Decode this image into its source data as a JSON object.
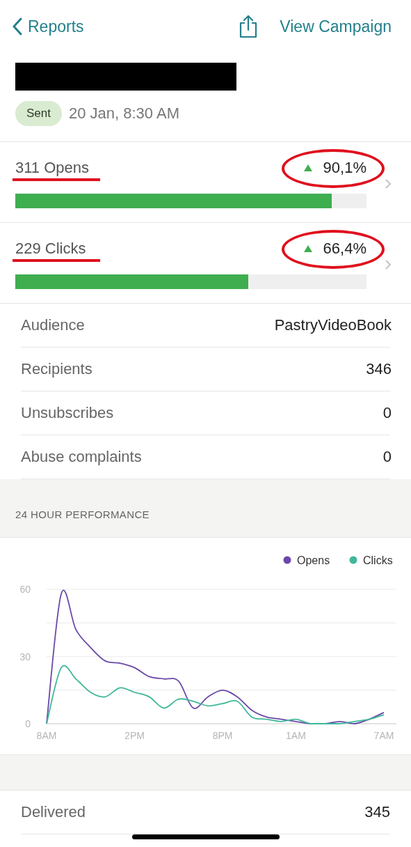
{
  "nav": {
    "back_label": "Reports",
    "action_label": "View Campaign"
  },
  "campaign": {
    "status": "Sent",
    "sent_at": "20 Jan, 8:30 AM"
  },
  "metrics": [
    {
      "label": "311 Opens",
      "change": "90,1%",
      "level": 0.901
    },
    {
      "label": "229 Clicks",
      "change": "66,4%",
      "level": 0.664
    }
  ],
  "details": [
    {
      "label": "Audience",
      "value": "PastryVideoBook"
    },
    {
      "label": "Recipients",
      "value": "346"
    },
    {
      "label": "Unsubscribes",
      "value": "0"
    },
    {
      "label": "Abuse complaints",
      "value": "0"
    }
  ],
  "performance": {
    "heading": "24 HOUR PERFORMANCE",
    "chart_data": {
      "type": "line",
      "categories": [
        "8AM",
        null,
        null,
        null,
        null,
        null,
        "2PM",
        null,
        null,
        null,
        null,
        null,
        "8PM",
        null,
        null,
        null,
        null,
        "1AM",
        null,
        null,
        null,
        null,
        null,
        "7AM"
      ],
      "yticks": [
        0,
        30,
        60
      ],
      "ylim": [
        0,
        60
      ],
      "legend": true,
      "series": [
        {
          "name": "Opens",
          "color": "#6a48a8",
          "values": [
            0,
            58,
            42,
            34,
            28,
            27,
            25,
            21,
            20,
            19,
            7,
            12,
            15,
            12,
            6,
            3,
            2,
            1,
            0,
            0,
            1,
            0,
            2,
            5
          ]
        },
        {
          "name": "Clicks",
          "color": "#3fb89a",
          "values": [
            0,
            25,
            20,
            14,
            12,
            16,
            14,
            12,
            7,
            11,
            10,
            8,
            9,
            10,
            3,
            2,
            1,
            2,
            0,
            0,
            0,
            1,
            2,
            4
          ]
        }
      ]
    }
  },
  "summary": [
    {
      "label": "Delivered",
      "value": "345"
    }
  ]
}
